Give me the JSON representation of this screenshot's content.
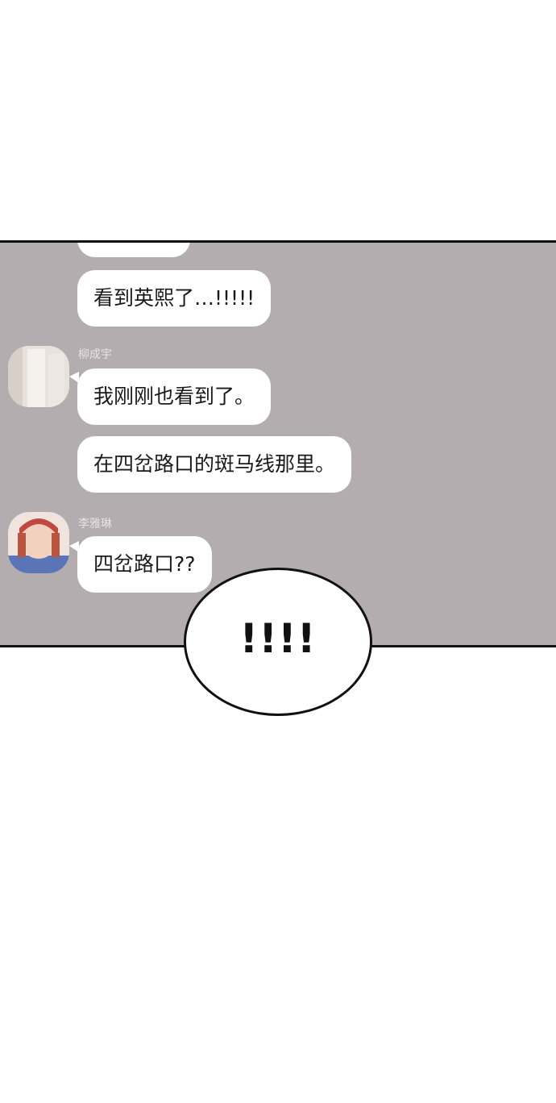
{
  "chat": {
    "messages": [
      {
        "text": "看到英熙了…!!!!!"
      },
      {
        "sender": "柳成宇",
        "text": "我刚刚也看到了。"
      },
      {
        "text": "在四岔路口的斑马线那里。"
      },
      {
        "sender": "李雅琳",
        "text": "四岔路口??"
      }
    ]
  },
  "speech_bubble": {
    "text": "!!!!"
  },
  "colors": {
    "chat_background": "#b3adb0",
    "bubble": "#ffffff",
    "border": "#111111"
  }
}
